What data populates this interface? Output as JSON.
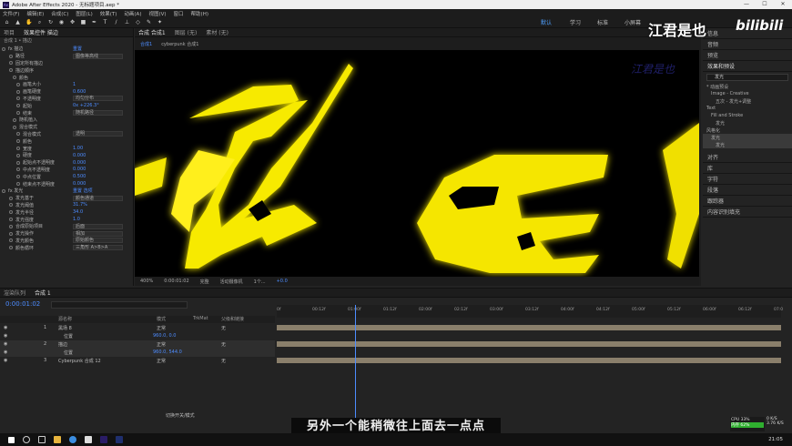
{
  "titlebar": {
    "app_icon": "Ae",
    "title": "Adobe After Effects 2020 - 无标题项目.aep *",
    "min": "—",
    "max": "☐",
    "close": "✕"
  },
  "menu": [
    "文件(F)",
    "编辑(E)",
    "合成(C)",
    "图层(L)",
    "效果(T)",
    "动画(A)",
    "视图(V)",
    "窗口",
    "帮助(H)"
  ],
  "workspaces": {
    "default": "默认",
    "learn": "学习",
    "standard": "标准",
    "small_screen": "小屏幕",
    "libraries": "库"
  },
  "left_panel": {
    "tabs": [
      "项目",
      "效果控件 描边"
    ],
    "comp_path": "合成 1 • 描边",
    "rows": [
      {
        "label": "fx  描边",
        "value": "重置",
        "indent": 2
      },
      {
        "label": "路径",
        "dropdown": "图像等高线",
        "indent": 10
      },
      {
        "label": "固定所有描边",
        "indent": 10
      },
      {
        "label": "描边顺序",
        "indent": 10
      },
      {
        "label": "颜色",
        "indent": 14
      },
      {
        "label": "画笔大小",
        "value": "1",
        "indent": 18
      },
      {
        "label": "画笔硬度",
        "value": "0.600",
        "indent": 18
      },
      {
        "label": "不透明度",
        "dropdown": "均匀分布",
        "indent": 18
      },
      {
        "label": "起始",
        "value": "0x +226.3°",
        "indent": 18
      },
      {
        "label": "结束",
        "dropdown": "随机路径",
        "indent": 18
      },
      {
        "label": "随机植入",
        "indent": 14
      },
      {
        "label": "混合模式",
        "indent": 14
      },
      {
        "label": "混合模式",
        "dropdown": "透明",
        "indent": 18
      },
      {
        "label": "颜色",
        "indent": 18
      },
      {
        "label": "宽度",
        "value": "1.00",
        "indent": 18
      },
      {
        "label": "硬度",
        "value": "0.000",
        "indent": 18
      },
      {
        "label": "起始点不透明度",
        "value": "0.000",
        "indent": 18
      },
      {
        "label": "中点不透明度",
        "value": "0.000",
        "indent": 18
      },
      {
        "label": "中点位置",
        "value": "0.500",
        "indent": 18
      },
      {
        "label": "结束点不透明度",
        "value": "0.000",
        "indent": 18
      },
      {
        "label": "fx  发光",
        "value": "重置  选项",
        "indent": 2
      },
      {
        "label": "发光基于",
        "dropdown": "颜色通道",
        "indent": 10
      },
      {
        "label": "发光阈值",
        "value": "31.7%",
        "indent": 10
      },
      {
        "label": "发光半径",
        "value": "34.0",
        "indent": 10
      },
      {
        "label": "发光强度",
        "value": "1.0",
        "indent": 10
      },
      {
        "label": "合成原始项目",
        "dropdown": "后面",
        "indent": 10
      },
      {
        "label": "发光操作",
        "dropdown": "相加",
        "indent": 10
      },
      {
        "label": "发光颜色",
        "dropdown": "原始颜色",
        "indent": 10
      },
      {
        "label": "颜色循环",
        "dropdown": "三角形 A>B>A",
        "indent": 10
      }
    ]
  },
  "viewer": {
    "tabs": [
      "合成 合成1",
      "图层 (无)",
      "素材 (无)"
    ],
    "breadcrumb": [
      "合成1",
      "cyberpunk 合成1"
    ],
    "watermark": "江君是也",
    "status": [
      "400%",
      "0:00:01:02",
      "完整",
      "活动摄像机",
      "1个...",
      "+0.0"
    ]
  },
  "right_panel": {
    "headers": [
      "信息",
      "音频",
      "预览",
      "效果和预设"
    ],
    "search": "发光",
    "tree": [
      "* 动画预设",
      "Image - Creative",
      "五次 - 发光+调整",
      "Text",
      "Fill and Stroke",
      "发光",
      "风格化",
      "发光",
      "发光"
    ],
    "sections": [
      "对齐",
      "库",
      "字符",
      "段落",
      "跟踪器",
      "内容识别填充"
    ]
  },
  "timeline": {
    "tabs": [
      "渲染队列",
      "合成 1"
    ],
    "timecode": "0:00:01:02",
    "columns": [
      "源名称",
      "模式",
      "TrkMat",
      "父级和链接"
    ],
    "layers": [
      {
        "num": "1",
        "name": "黑场 8",
        "mode": "正常",
        "parent": "无"
      },
      {
        "num": "",
        "name": "位置",
        "mode": "",
        "parent": "960.0, 0.0"
      },
      {
        "num": "2",
        "name": "描边",
        "mode": "正常",
        "parent": "无"
      },
      {
        "num": "",
        "name": "位置",
        "mode": "",
        "parent": "960.0, 544.0"
      },
      {
        "num": "3",
        "name": "Cyberpunk 合成 12",
        "mode": "正常",
        "parent": "无"
      }
    ],
    "ruler": [
      "0f",
      "00:12f",
      "01:00f",
      "01:12f",
      "02:00f",
      "02:12f",
      "03:00f",
      "03:12f",
      "04:00f",
      "04:12f",
      "05:00f",
      "05:12f",
      "06:00f",
      "06:12f",
      "07:0"
    ],
    "footer": "切换开关/模式"
  },
  "subtitle": "另外一个能稍微往上面去一点点",
  "brand": "江君是也",
  "bili": "bilibili",
  "tray": {
    "cpu": "CPU 33%",
    "mem": "内存 62%",
    "net_up": "0 K/S",
    "net_down": "3.76 K/S",
    "time": "21:05"
  },
  "colors": {
    "accent": "#4d8cff",
    "glow": "#ffef00"
  }
}
